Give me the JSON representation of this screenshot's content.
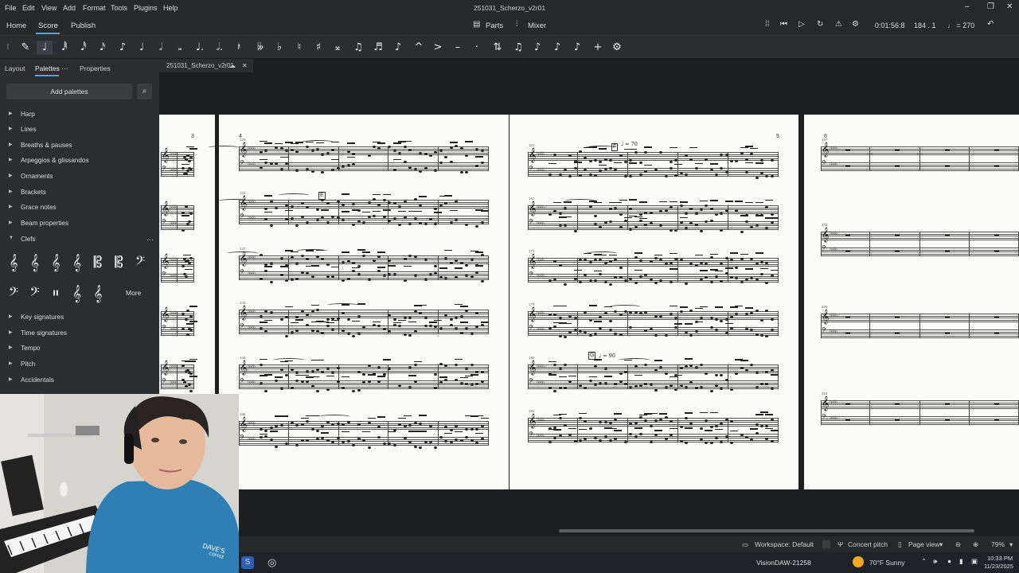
{
  "window": {
    "title": "251031_Scherzo_v2r01",
    "controls": [
      "–",
      "❐",
      "✕"
    ]
  },
  "menu": [
    "File",
    "Edit",
    "View",
    "Add",
    "Format",
    "Tools",
    "Plugins",
    "Help"
  ],
  "nav": {
    "tabs": [
      "Home",
      "Score",
      "Publish"
    ],
    "parts_label": "Parts",
    "mixer_label": "Mixer",
    "time": "0:01:56:8",
    "position": "184 . 1",
    "tempo": "♩ = 270"
  },
  "toolbar": {
    "tools": [
      {
        "icon": "pencil-icon",
        "glyph": "✎"
      },
      {
        "icon": "note-input-icon",
        "glyph": "♩"
      },
      {
        "icon": "64th-note-icon",
        "glyph": "𝅘𝅥𝅱"
      },
      {
        "icon": "32nd-note-icon",
        "glyph": "𝅘𝅥𝅰"
      },
      {
        "icon": "16th-note-icon",
        "glyph": "𝅘𝅥𝅯"
      },
      {
        "icon": "eighth-note-icon",
        "glyph": "♪"
      },
      {
        "icon": "quarter-note-icon",
        "glyph": "♩"
      },
      {
        "icon": "half-note-icon",
        "glyph": "𝅗𝅥"
      },
      {
        "icon": "whole-note-icon",
        "glyph": "𝅝"
      },
      {
        "icon": "dotted-quarter-icon",
        "glyph": "♩."
      },
      {
        "icon": "dotted-half-icon",
        "glyph": "𝅗𝅥."
      },
      {
        "icon": "rest-icon",
        "glyph": "𝄽"
      },
      {
        "icon": "double-flat-icon",
        "glyph": "𝄫"
      },
      {
        "icon": "flat-icon",
        "glyph": "♭"
      },
      {
        "icon": "natural-icon",
        "glyph": "♮"
      },
      {
        "icon": "sharp-icon",
        "glyph": "♯"
      },
      {
        "icon": "double-sharp-icon",
        "glyph": "𝄪"
      },
      {
        "icon": "tie-icon",
        "glyph": "♫"
      },
      {
        "icon": "slur-icon",
        "glyph": "♬"
      },
      {
        "icon": "tuplet-icon",
        "glyph": "♪"
      },
      {
        "icon": "marcato-icon",
        "glyph": "^"
      },
      {
        "icon": "accent-icon",
        "glyph": ">"
      },
      {
        "icon": "tenuto-icon",
        "glyph": "–"
      },
      {
        "icon": "staccato-icon",
        "glyph": "·"
      },
      {
        "icon": "flip-direction-icon",
        "glyph": "⇅"
      },
      {
        "icon": "beam-icon",
        "glyph": "♫"
      },
      {
        "icon": "voice-1-icon",
        "glyph": "♪"
      },
      {
        "icon": "voice-2-icon",
        "glyph": "♪"
      },
      {
        "icon": "voice-3-icon",
        "glyph": "♪"
      },
      {
        "icon": "add-icon",
        "glyph": "+"
      },
      {
        "icon": "toolbar-settings-icon",
        "glyph": "⚙"
      }
    ]
  },
  "panel": {
    "tabs": [
      "Layout",
      "Palettes",
      "Properties"
    ],
    "add_palettes": "Add palettes",
    "items": [
      "Harp",
      "Lines",
      "Breaths & pauses",
      "Arpeggios & glissandos",
      "Ornaments",
      "Brackets",
      "Grace notes",
      "Beam properties",
      "Clefs"
    ],
    "clefs_row1": [
      "𝄞",
      "𝄞",
      "𝄞",
      "𝄞",
      "𝄡",
      "𝄡",
      "𝄢"
    ],
    "clefs_row2": [
      "𝄢",
      "𝄢",
      "𝄥",
      "𝄞",
      "𝄞"
    ],
    "more": "More",
    "items_after": [
      "Key signatures",
      "Time signatures",
      "Tempo",
      "Pitch",
      "Accidentals"
    ]
  },
  "document_tab": {
    "label": "251031_Scherzo_v2r01"
  },
  "score": {
    "page_numbers": [
      "3",
      "4",
      "5",
      "6"
    ],
    "rehearsal_marks": [
      "E",
      "F",
      "G"
    ],
    "tempo_marks": [
      "♩ = 70",
      "♩ = 90"
    ],
    "measure_numbers": [
      "125",
      "131",
      "137",
      "143",
      "149",
      "155",
      "161",
      "167",
      "173",
      "179",
      "185",
      "191",
      "197",
      "203",
      "209",
      "215"
    ]
  },
  "status": {
    "workspace": "Workspace: Default",
    "concert_pitch": "Concert pitch",
    "view_mode": "Page view",
    "zoom": "79%"
  },
  "taskbar": {
    "app": "VisionDAW-21258",
    "weather": "70°F Sunny",
    "time": "10:33 PM",
    "date": "11/23/2025"
  }
}
